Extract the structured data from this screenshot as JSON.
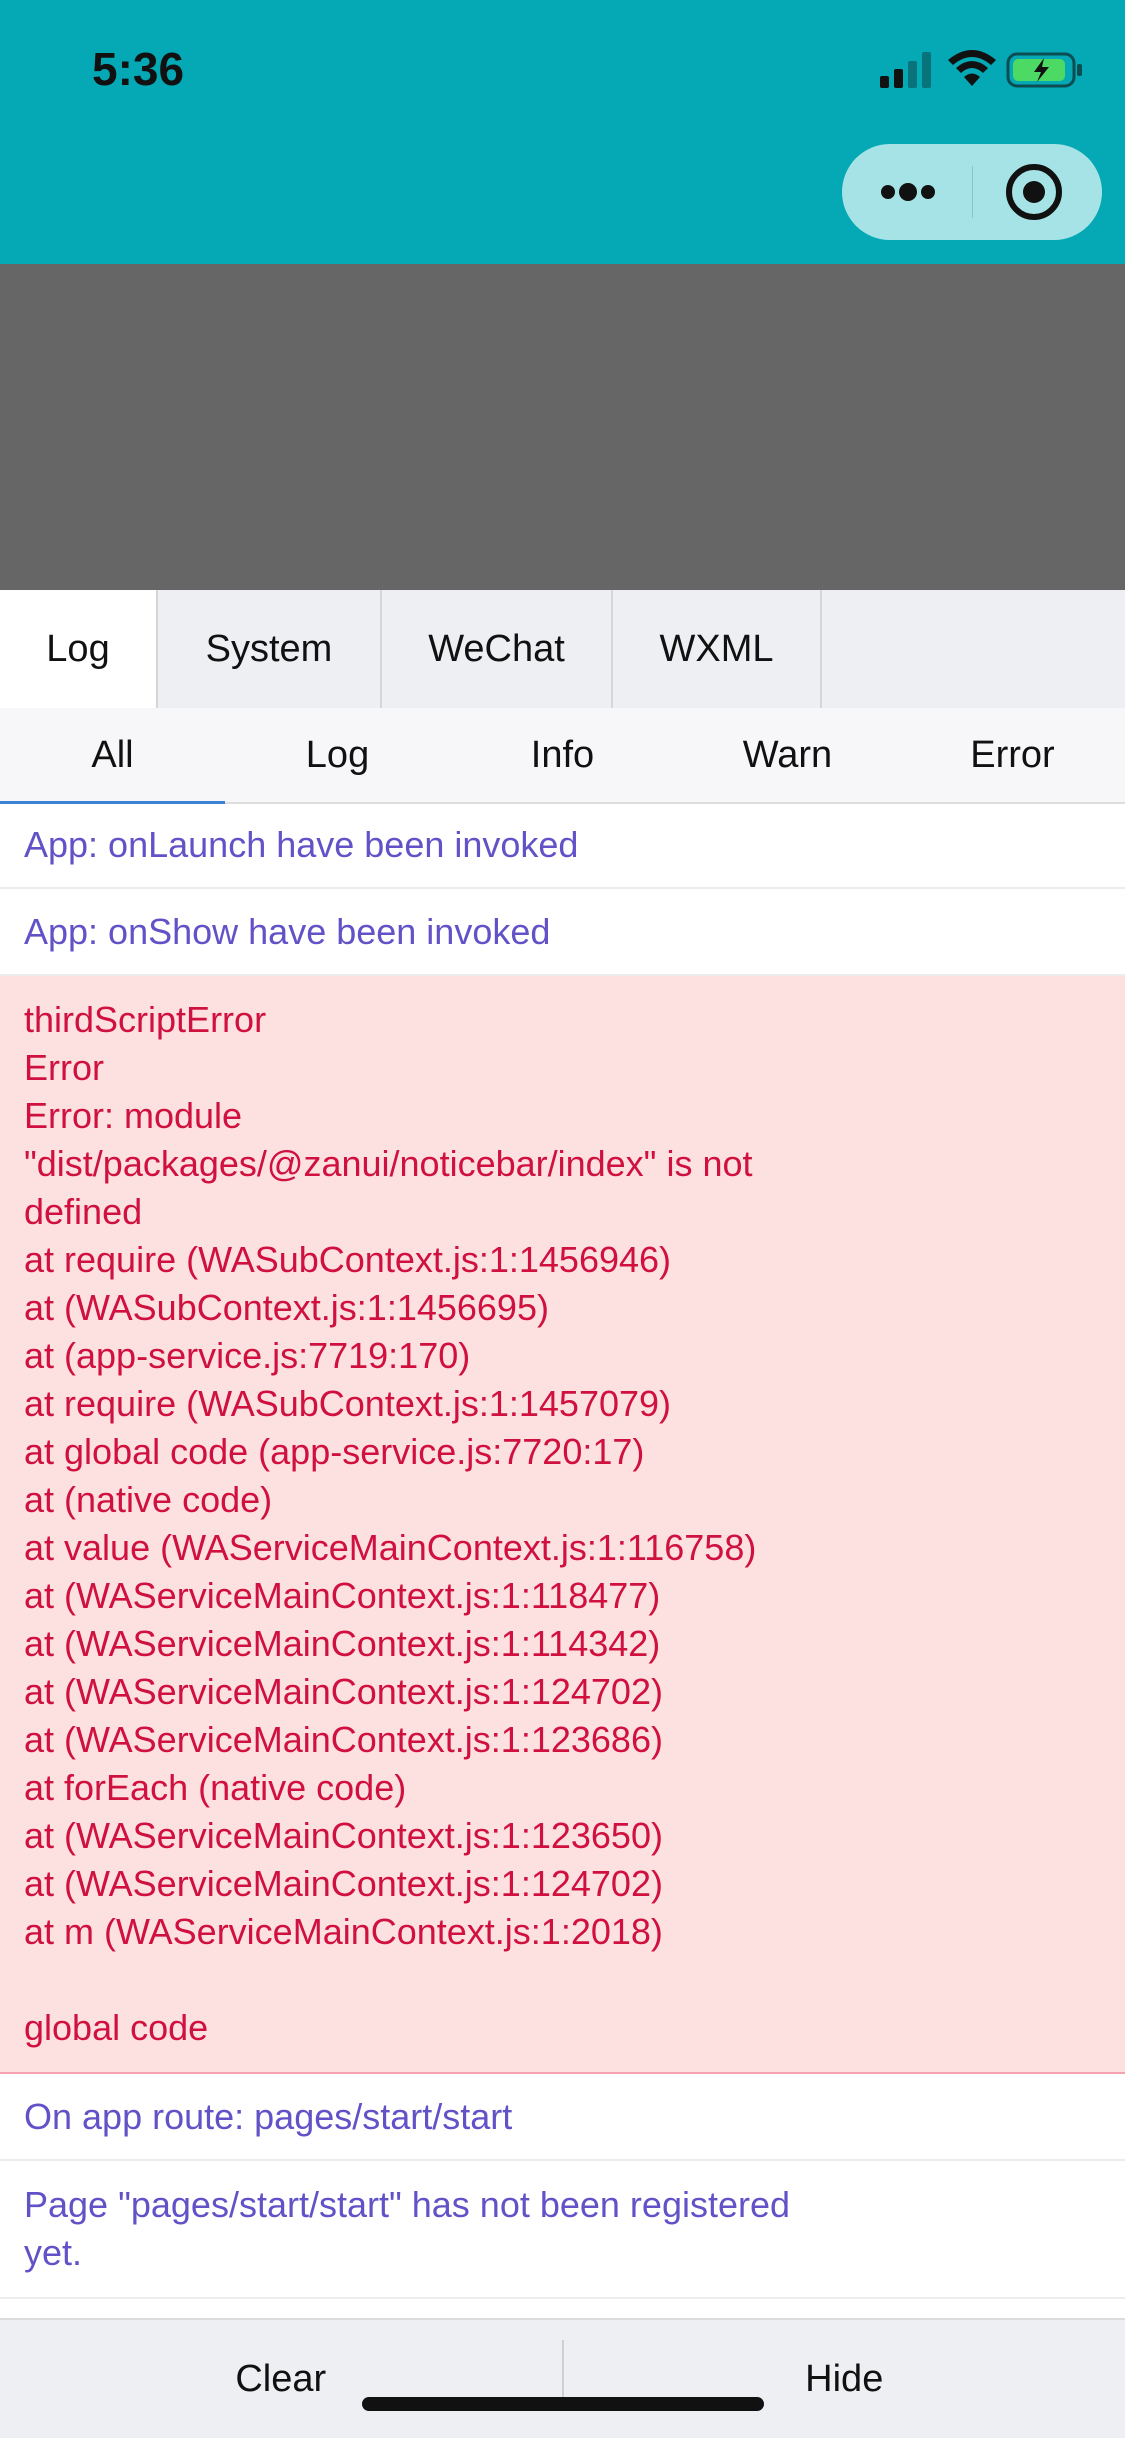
{
  "status_bar": {
    "time": "5:36",
    "signal_icon": "signal-bars-icon",
    "wifi_icon": "wifi-icon",
    "battery_icon": "battery-charging-icon"
  },
  "capsule": {
    "more_icon": "more-dots-icon",
    "target_icon": "target-circle-icon"
  },
  "main_tabs": [
    {
      "label": "Log",
      "active": true
    },
    {
      "label": "System",
      "active": false
    },
    {
      "label": "WeChat",
      "active": false
    },
    {
      "label": "WXML",
      "active": false
    }
  ],
  "sub_tabs": [
    {
      "label": "All",
      "active": true
    },
    {
      "label": "Log",
      "active": false
    },
    {
      "label": "Info",
      "active": false
    },
    {
      "label": "Warn",
      "active": false
    },
    {
      "label": "Error",
      "active": false
    }
  ],
  "logs": {
    "entry1": "App: onLaunch have been invoked",
    "entry2": "App: onShow have been invoked",
    "error_lines": [
      "thirdScriptError",
      "Error",
      "Error: module",
      "\"dist/packages/@zanui/noticebar/index\" is not",
      "defined",
      "at require (WASubContext.js:1:1456946)",
      "at (WASubContext.js:1:1456695)",
      "at (app-service.js:7719:170)",
      "at require (WASubContext.js:1:1457079)",
      "at global code (app-service.js:7720:17)",
      "at (native code)",
      "at value (WAServiceMainContext.js:1:116758)",
      "at (WAServiceMainContext.js:1:118477)",
      "at (WAServiceMainContext.js:1:114342)",
      "at (WAServiceMainContext.js:1:124702)",
      "at (WAServiceMainContext.js:1:123686)",
      "at forEach (native code)",
      "at (WAServiceMainContext.js:1:123650)",
      "at (WAServiceMainContext.js:1:124702)",
      "at m (WAServiceMainContext.js:1:2018)",
      "",
      "global code"
    ],
    "entry3": "On app route: pages/start/start",
    "entry4_line1": "Page \"pages/start/start\" has not been registered",
    "entry4_line2": "yet."
  },
  "bottom_bar": {
    "clear_label": "Clear",
    "hide_label": "Hide"
  },
  "colors": {
    "header_bg": "#05a8b5",
    "preview_bg": "#666666",
    "log_text": "#6252c8",
    "error_text": "#d0103e",
    "error_bg": "#fde1e1"
  }
}
